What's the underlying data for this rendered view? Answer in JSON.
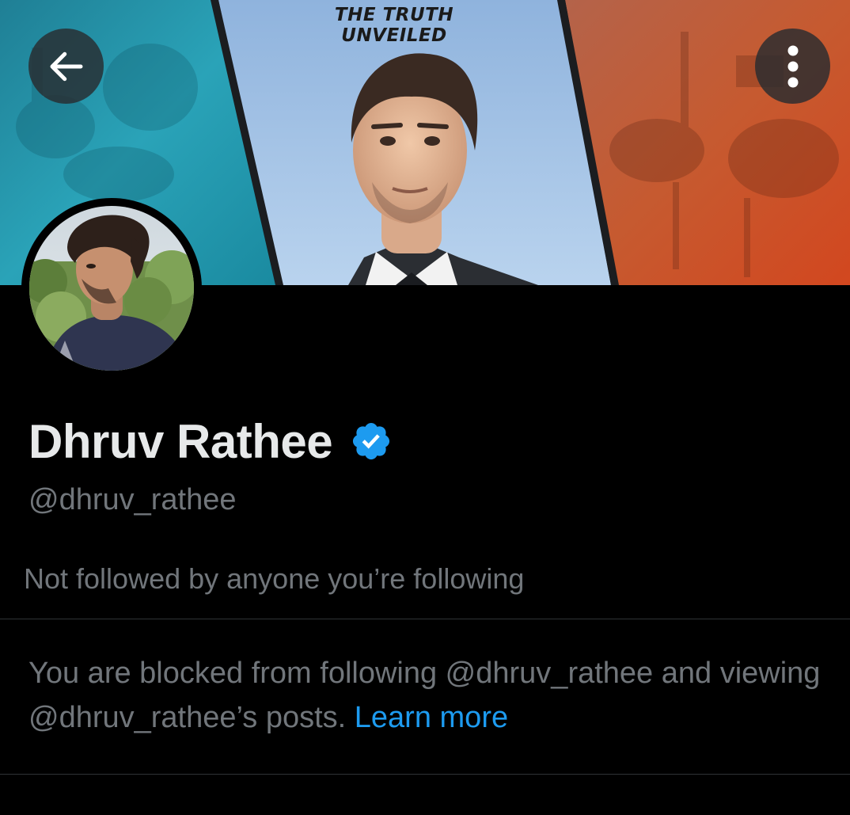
{
  "banner": {
    "title": "THE TRUTH UNVEILED",
    "colors": {
      "left_panel": "#2a9fb3",
      "center_panel": "#a7c8ea",
      "right_panel": "#c2552d"
    }
  },
  "header": {
    "back_icon": "arrow-left-icon",
    "more_icon": "more-vertical-icon"
  },
  "profile": {
    "display_name": "Dhruv Rathee",
    "verified": true,
    "handle": "@dhruv_rathee",
    "followers_you_know": "Not followed by anyone you’re following"
  },
  "blocked": {
    "message": "You are blocked from following @dhruv_rathee and viewing @dhruv_rathee’s posts.",
    "link_label": "Learn more"
  },
  "theme": {
    "background": "#000000",
    "primary_text": "#e7e9ea",
    "secondary_text": "#71767b",
    "accent": "#1d9bf0",
    "divider": "#2f3336"
  }
}
